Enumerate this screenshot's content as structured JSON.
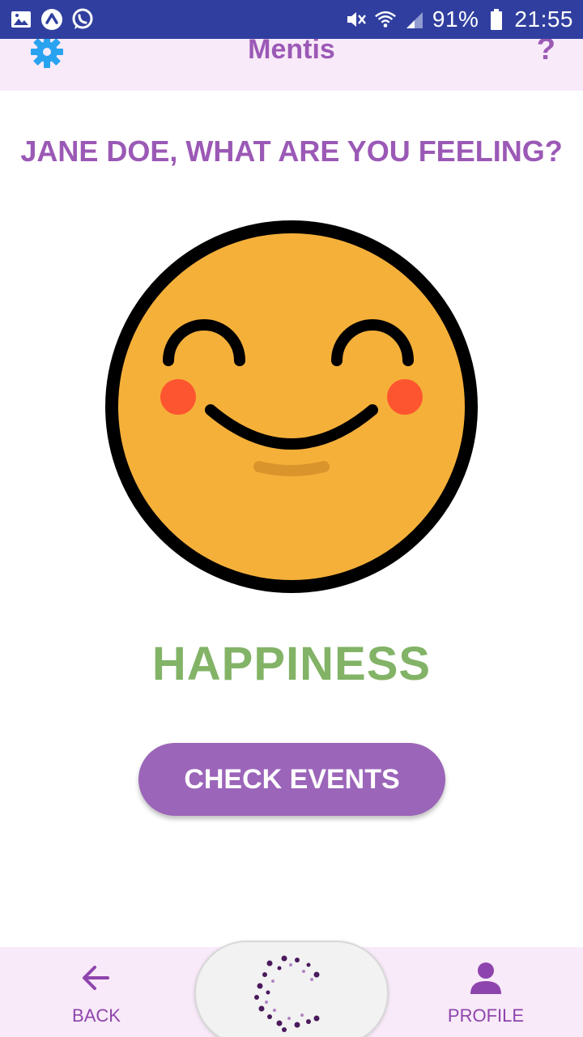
{
  "status_bar": {
    "battery_percent": "91%",
    "time": "21:55",
    "left_icons": [
      "image-icon",
      "arrow-up-circle-icon",
      "whatsapp-icon"
    ],
    "right_icons": [
      "mute-icon",
      "wifi-icon",
      "signal-icon",
      "battery-icon"
    ]
  },
  "header": {
    "title": "Mentis",
    "help_label": "?"
  },
  "main": {
    "question": "JANE DOE, WHAT ARE YOU FEELING?",
    "emotion": "HAPPINESS",
    "check_events_label": "CHECK EVENTS"
  },
  "bottom_nav": {
    "back_label": "BACK",
    "profile_label": "PROFILE"
  },
  "colors": {
    "status_bar": "#303f9f",
    "header_bg": "#f8eaf8",
    "accent_purple": "#9b59b6",
    "emotion_green": "#82b366",
    "settings_blue": "#29a3f0",
    "face_yellow": "#f5b03a",
    "cheek_red": "#fd5530"
  }
}
